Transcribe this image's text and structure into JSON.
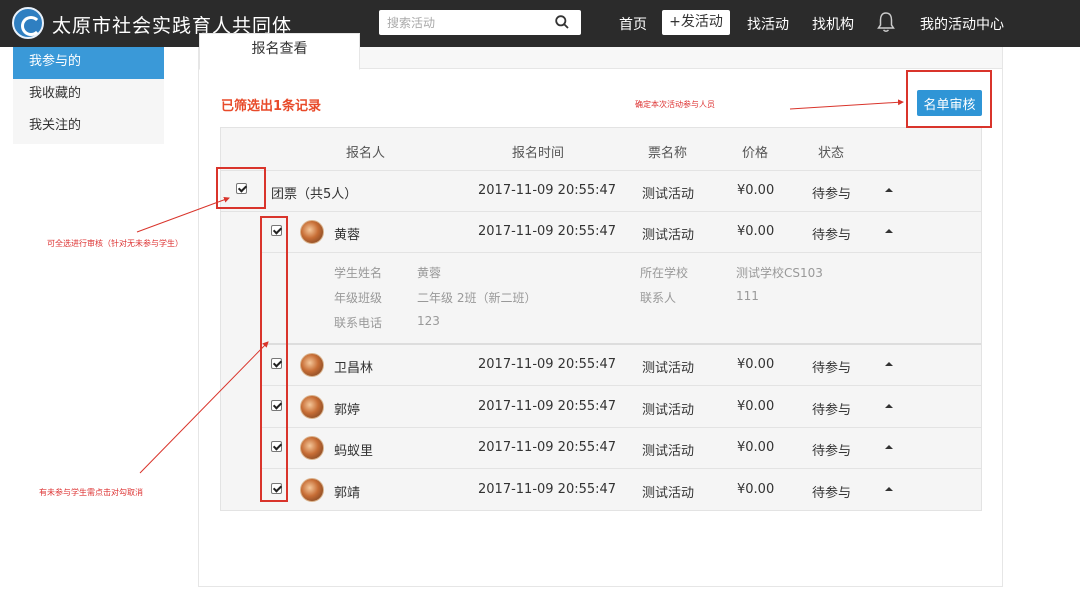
{
  "header": {
    "site_title": "太原市社会实践育人共同体",
    "search_placeholder": "搜索活动",
    "nav": {
      "home": "首页",
      "post": "+发活动",
      "find_activity": "找活动",
      "find_org": "找机构",
      "my_center": "我的活动中心"
    }
  },
  "sidebar": {
    "items": [
      {
        "label": "我参与的"
      },
      {
        "label": "我收藏的"
      },
      {
        "label": "我关注的"
      }
    ]
  },
  "main": {
    "tab_label": "报名查看",
    "record_count": "已筛选出1条记录",
    "top_note": "确定本次活动参与人员",
    "review_button": "名单审核"
  },
  "table": {
    "columns": [
      "报名人",
      "报名时间",
      "票名称",
      "价格",
      "状态"
    ],
    "group": {
      "name": "团票（共5人）",
      "time": "2017-11-09 20:55:47",
      "ticket": "测试活动",
      "price": "¥0.00",
      "status": "待参与"
    },
    "members": [
      {
        "name": "黄蓉",
        "time": "2017-11-09 20:55:47",
        "ticket": "测试活动",
        "price": "¥0.00",
        "status": "待参与"
      },
      {
        "name": "卫昌林",
        "time": "2017-11-09 20:55:47",
        "ticket": "测试活动",
        "price": "¥0.00",
        "status": "待参与"
      },
      {
        "name": "郭婷",
        "time": "2017-11-09 20:55:47",
        "ticket": "测试活动",
        "price": "¥0.00",
        "status": "待参与"
      },
      {
        "name": "蚂蚁里",
        "time": "2017-11-09 20:55:47",
        "ticket": "测试活动",
        "price": "¥0.00",
        "status": "待参与"
      },
      {
        "name": "郭靖",
        "time": "2017-11-09 20:55:47",
        "ticket": "测试活动",
        "price": "¥0.00",
        "status": "待参与"
      }
    ],
    "detail": {
      "student_name_label": "学生姓名",
      "student_name": "黄蓉",
      "school_label": "所在学校",
      "school": "测试学校CS103",
      "grade_label": "年级班级",
      "grade": "二年级 2班（新二班）",
      "contact_label": "联系人",
      "contact": "111",
      "phone_label": "联系电话",
      "phone": "123"
    }
  },
  "annotations": {
    "select_all_note": "可全选进行审核（针对无未参与学生）",
    "uncheck_note": "有未参与学生需点击对勾取消"
  },
  "colors": {
    "accent": "#3a99d8",
    "button": "#2f95d6",
    "header_bg": "#2b2b2b",
    "highlight_red": "#d9342b",
    "count_text": "#e84a2a"
  }
}
